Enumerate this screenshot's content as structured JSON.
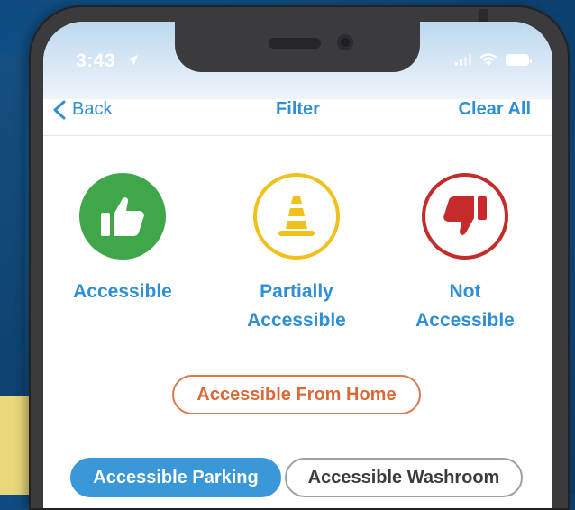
{
  "status_bar": {
    "time": "3:43",
    "icons": [
      "location-arrow-icon",
      "signal-icon",
      "wifi-icon",
      "battery-icon"
    ]
  },
  "nav": {
    "back_label": "Back",
    "title": "Filter",
    "clear_label": "Clear All"
  },
  "options": [
    {
      "label_line1": "Accessible",
      "label_line2": "",
      "icon": "thumbs-up-icon",
      "color": "#3fa64a",
      "selected": true
    },
    {
      "label_line1": "Partially",
      "label_line2": "Accessible",
      "icon": "traffic-cone-icon",
      "color": "#f0c11c",
      "selected": false
    },
    {
      "label_line1": "Not",
      "label_line2": "Accessible",
      "icon": "thumbs-down-icon",
      "color": "#c62b2b",
      "selected": false
    }
  ],
  "chips": {
    "home": "Accessible From Home",
    "parking": "Accessible Parking",
    "washroom": "Accessible Washroom"
  },
  "colors": {
    "accent": "#2f8fd4",
    "home_chip": "#d96a38",
    "selected_chip": "#3a97d8"
  }
}
